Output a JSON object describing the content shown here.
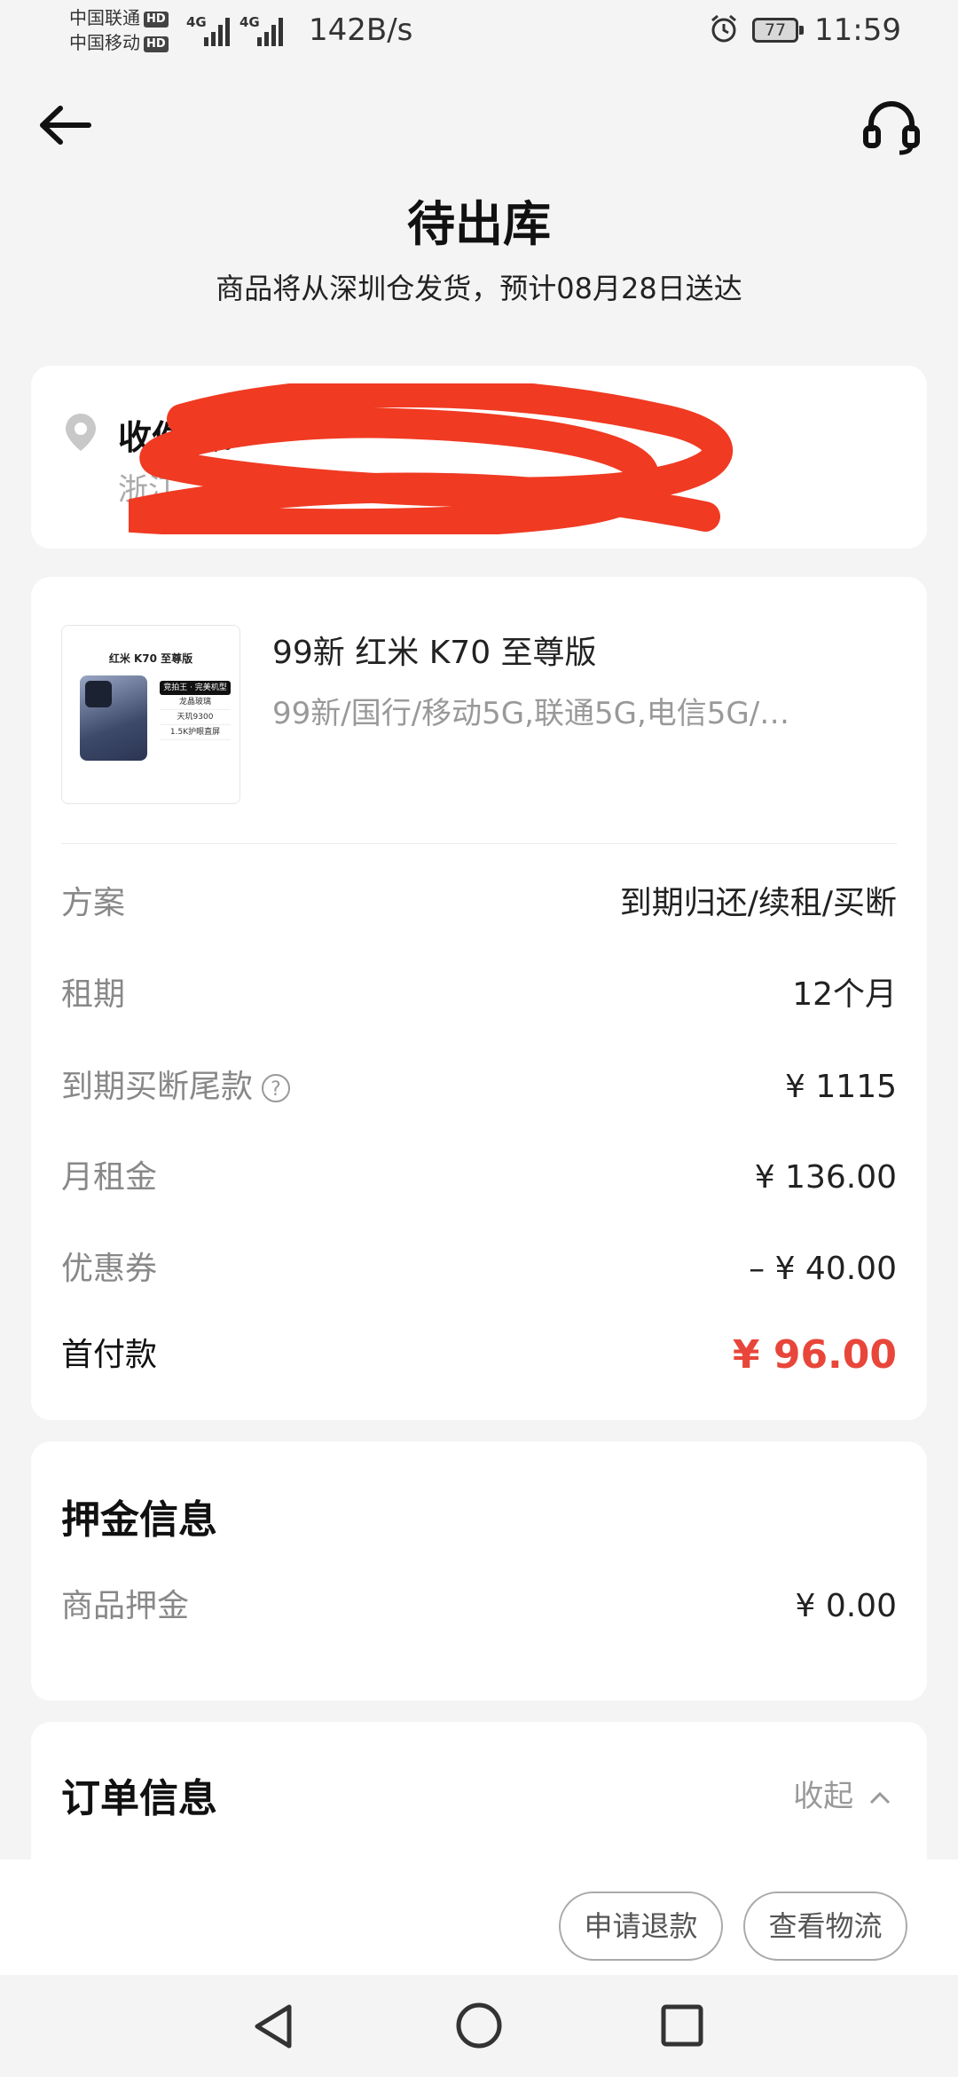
{
  "status_bar": {
    "carrier1": "中国联通",
    "carrier2": "中国移动",
    "hd": "HD",
    "net": "4G",
    "speed": "142B/s",
    "battery": "77",
    "time": "11:59"
  },
  "header": {
    "title": "待出库",
    "subtitle": "商品将从深圳仓发货，预计08月28日送达"
  },
  "address": {
    "label": "收件人：",
    "line_prefix": "浙江"
  },
  "product": {
    "thumb_title": "红米 K70 至尊版",
    "thumb_tag_header": "竞拍王 · 完美机型",
    "thumb_tags": [
      "龙晶玻璃",
      "天玑9300",
      "1.5K护眼直屏"
    ],
    "name": "99新 红米 K70 至尊版",
    "spec": "99新/国行/移动5G,联通5G,电信5G/…"
  },
  "rows": [
    {
      "label": "方案",
      "value": "到期归还/续租/买断"
    },
    {
      "label": "租期",
      "value": "12个月"
    },
    {
      "label": "到期买断尾款",
      "value": "¥ 1115"
    },
    {
      "label": "月租金",
      "value": "¥ 136.00"
    },
    {
      "label": "优惠券",
      "value": "– ¥ 40.00"
    },
    {
      "label": "首付款",
      "value": "¥ 96.00"
    }
  ],
  "deposit": {
    "title": "押金信息",
    "label": "商品押金",
    "value": "¥ 0.00"
  },
  "order_info": {
    "title": "订单信息",
    "collapse": "收起"
  },
  "actions": {
    "refund": "申请退款",
    "logistics": "查看物流"
  },
  "colors": {
    "accent_red": "#e8463a",
    "redaction": "#f03a22"
  }
}
